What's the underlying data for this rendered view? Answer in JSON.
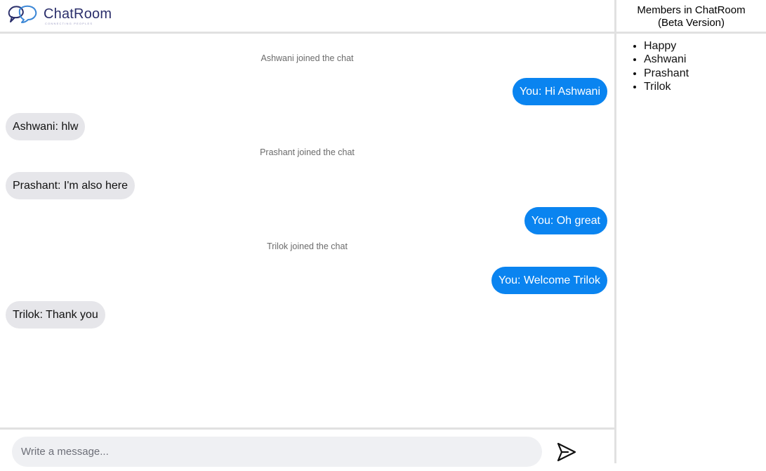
{
  "app": {
    "name": "ChatRoom",
    "tagline": "CONNECTING PEOPLES"
  },
  "messages": [
    {
      "type": "notice",
      "text": "Ashwani joined the chat"
    },
    {
      "type": "out",
      "text": "You: Hi Ashwani"
    },
    {
      "type": "in",
      "text": "Ashwani: hlw"
    },
    {
      "type": "notice",
      "text": "Prashant joined the chat"
    },
    {
      "type": "in",
      "text": "Prashant: I'm also here"
    },
    {
      "type": "out",
      "text": "You: Oh great"
    },
    {
      "type": "notice",
      "text": "Trilok joined the chat"
    },
    {
      "type": "out",
      "text": "You: Welcome Trilok"
    },
    {
      "type": "in",
      "text": "Trilok: Thank you"
    }
  ],
  "composer": {
    "placeholder": "Write a message...",
    "value": "",
    "send_icon": "send-icon"
  },
  "members": {
    "title_line1": "Members in ChatRoom",
    "title_line2": "(Beta Version)",
    "list": [
      "Happy",
      "Ashwani",
      "Prashant",
      "Trilok"
    ]
  },
  "colors": {
    "outgoing_bubble": "#0a84f0",
    "incoming_bubble": "#e6e6ea",
    "divider": "#e1e1e1",
    "brand": "#2b2f6b"
  }
}
